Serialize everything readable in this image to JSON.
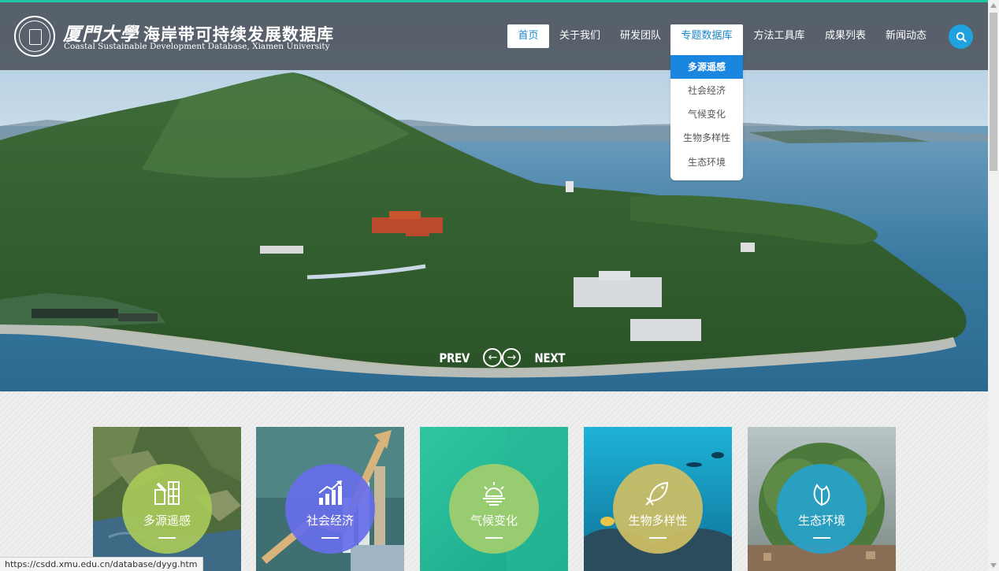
{
  "header": {
    "logo_university": "厦門大學",
    "logo_title": "海岸带可持续发展数据库",
    "logo_subtitle": "Coastal Sustainable Development Database, Xiamen University"
  },
  "nav": {
    "items": [
      {
        "label": "首页",
        "state": "active"
      },
      {
        "label": "关于我们",
        "state": "normal"
      },
      {
        "label": "研发团队",
        "state": "normal"
      },
      {
        "label": "专题数据库",
        "state": "open"
      },
      {
        "label": "方法工具库",
        "state": "normal"
      },
      {
        "label": "成果列表",
        "state": "normal"
      },
      {
        "label": "新闻动态",
        "state": "normal"
      }
    ],
    "search_icon": "search-icon"
  },
  "dropdown": {
    "items": [
      "多源遥感",
      "社会经济",
      "气候变化",
      "生物多样性",
      "生态环境"
    ],
    "selected_index": 0
  },
  "hero": {
    "prev_label": "PREV",
    "next_label": "NEXT"
  },
  "cards": [
    {
      "title": "多源遥感",
      "icon": "satellite-icon"
    },
    {
      "title": "社会经济",
      "icon": "chart-growth-icon"
    },
    {
      "title": "气候变化",
      "icon": "sunrise-icon"
    },
    {
      "title": "生物多样性",
      "icon": "fish-icon"
    },
    {
      "title": "生态环境",
      "icon": "leaf-icon"
    }
  ],
  "colors": {
    "accent": "#1a86c8",
    "topline": "#1fc7a6",
    "search": "#1fa3e0"
  },
  "status_bar": {
    "url": "https://csdd.xmu.edu.cn/database/dyyg.htm"
  }
}
